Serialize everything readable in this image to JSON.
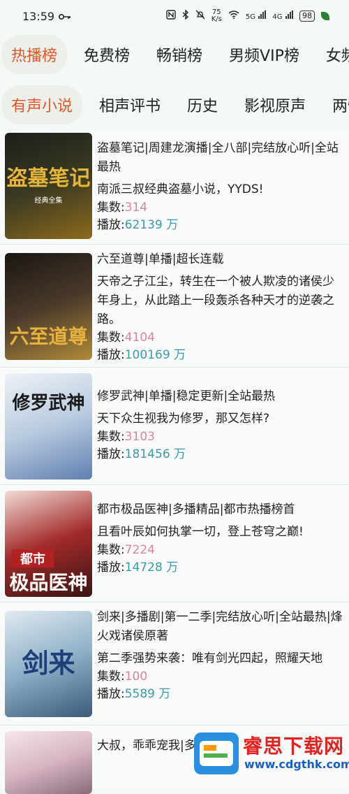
{
  "status_bar": {
    "time": "13:59",
    "net_speed_value": "75",
    "net_speed_unit": "K/s",
    "battery": "98",
    "signal_5g": "5G",
    "signal_4g": "4G"
  },
  "tabs_primary": [
    {
      "label": "热播榜",
      "active": true
    },
    {
      "label": "免费榜",
      "active": false
    },
    {
      "label": "畅销榜",
      "active": false
    },
    {
      "label": "男频VIP榜",
      "active": false
    },
    {
      "label": "女频VIP榜",
      "active": false
    }
  ],
  "tabs_secondary": [
    {
      "label": "有声小说",
      "active": true
    },
    {
      "label": "相声评书",
      "active": false
    },
    {
      "label": "历史",
      "active": false
    },
    {
      "label": "影视原声",
      "active": false
    },
    {
      "label": "两性情感",
      "active": false
    }
  ],
  "meta_labels": {
    "episodes": "集数:",
    "plays": "播放:",
    "unit": " 万"
  },
  "books": [
    {
      "title": "盗墓笔记|周建龙演播|全八部|完结放心听|全站最热",
      "desc": "南派三叔经典盗墓小说，YYDS!",
      "episodes": "314",
      "plays": "62139",
      "cover_title": "盗墓笔记",
      "cover_sub": "经典全集",
      "cover_colors": [
        "#1c1e1a",
        "#3b3a22",
        "#8c6a1c"
      ]
    },
    {
      "title": "六至道尊|单播|超长连载",
      "desc": "天帝之子江尘，转生在一个被人欺凌的诸侯少年身上，从此踏上一段轰杀各种天才的逆袭之路。",
      "episodes": "4104",
      "plays": "100169",
      "cover_title": "六至道尊",
      "cover_sub": "",
      "cover_colors": [
        "#1a1613",
        "#4a3a2a",
        "#b08a3a"
      ]
    },
    {
      "title": "修罗武神|单播|稳定更新|全站最热",
      "desc": "天下众生视我为修罗，那又怎样?",
      "episodes": "3103",
      "plays": "181456",
      "cover_title": "修罗武神",
      "cover_sub": "",
      "cover_colors": [
        "#eef2f6",
        "#b9cbe0",
        "#5f7fb0"
      ]
    },
    {
      "title": "都市极品医神|多播精品|都市热播榜首",
      "desc": "且看叶辰如何执掌一切，登上苍穹之巅!",
      "episodes": "7224",
      "plays": "14728",
      "cover_title": "极品医神",
      "cover_sub": "都市",
      "cover_colors": [
        "#f2dcd6",
        "#a22a2a",
        "#3a1414"
      ]
    },
    {
      "title": "剑来|多播剧|第一二季|完结放心听|全站最热|烽火戏诸侯原著",
      "desc": "第二季强势来袭：唯有剑光四起，照耀天地",
      "episodes": "100",
      "plays": "5589",
      "cover_title": "剑来",
      "cover_sub": "",
      "cover_colors": [
        "#dfeaf0",
        "#8fb0c8",
        "#3a5a7a"
      ]
    },
    {
      "title": "大叔，乖乖宠我|多播宠",
      "desc": "",
      "episodes": "",
      "plays": "",
      "cover_title": "",
      "cover_sub": "",
      "cover_colors": [
        "#f5e6ea",
        "#d8b6c4",
        "#8a6a7a"
      ]
    }
  ],
  "watermark": {
    "name": "睿思下载网",
    "url": "www.cdgthk.com"
  }
}
